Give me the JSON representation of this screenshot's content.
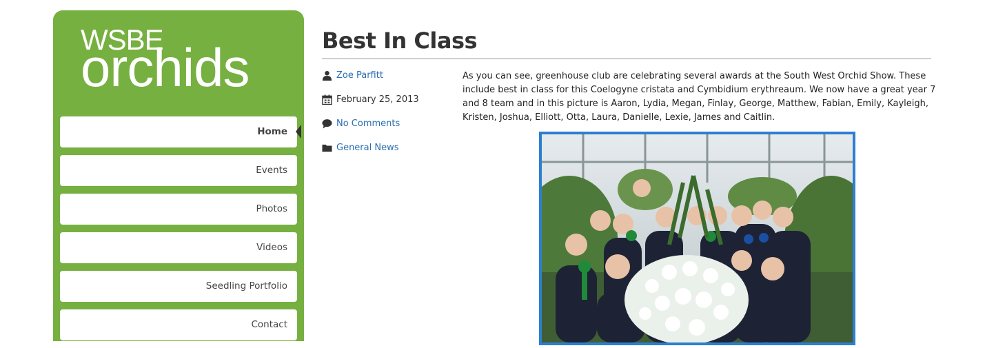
{
  "logo": {
    "line1": "WSBE",
    "line2": "orchids"
  },
  "nav": {
    "items": [
      {
        "label": "Home",
        "active": true
      },
      {
        "label": "Events",
        "active": false
      },
      {
        "label": "Photos",
        "active": false
      },
      {
        "label": "Videos",
        "active": false
      },
      {
        "label": "Seedling Portfolio",
        "active": false
      },
      {
        "label": "Contact",
        "active": false
      }
    ]
  },
  "post": {
    "title": "Best In Class",
    "author": "Zoe Parfitt",
    "date": "February 25, 2013",
    "comments": "No Comments",
    "category": "General News",
    "body": "As you can see, greenhouse club are celebrating several awards at the South West Orchid Show. These include best in class for this Coelogyne cristata and Cymbidium erythreaum. We now have a great year 7 and 8 team and in this picture is Aaron, Lydia, Megan, Finlay, George, Matthew, Fabian, Emily, Kayleigh, Kristen, Joshua, Elliott, Otta, Laura, Danielle, Lexie, James and Caitlin."
  },
  "icons": {
    "author": "person-icon",
    "date": "calendar-icon",
    "comments": "speech-bubble-icon",
    "category": "folder-icon"
  },
  "colors": {
    "sidebar_green": "#76b041",
    "link_blue": "#2a6db2",
    "photo_border": "#2d7fd0"
  }
}
